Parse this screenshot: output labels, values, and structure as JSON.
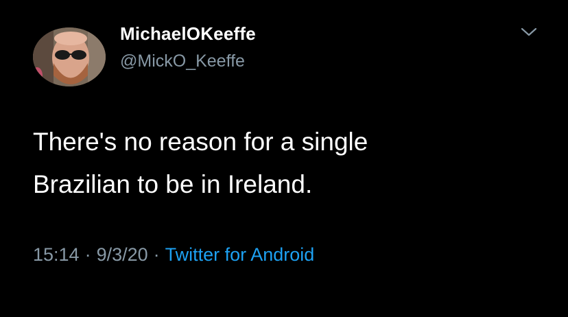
{
  "tweet": {
    "author": {
      "display_name": "MichaelOKeeffe",
      "handle": "@MickO_Keeffe",
      "avatar_icon": "profile-photo"
    },
    "menu_icon": "chevron-down-icon",
    "text_lines": [
      "There's no reason for a single",
      "Brazilian to be in Ireland."
    ],
    "meta": {
      "time": "15:14",
      "separator": "·",
      "date": "9/3/20",
      "source": "Twitter for Android"
    }
  },
  "colors": {
    "background": "#000000",
    "primary_text": "#ffffff",
    "secondary_text": "#8899a6",
    "link": "#1da1f2"
  }
}
